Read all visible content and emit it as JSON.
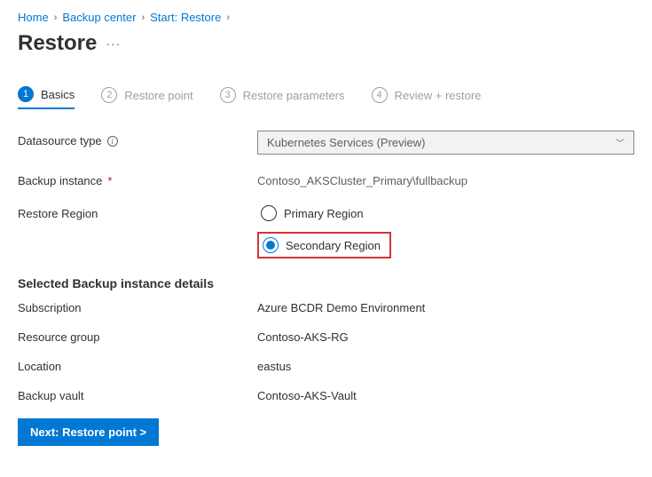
{
  "breadcrumb": {
    "home": "Home",
    "backup_center": "Backup center",
    "start_restore": "Start: Restore"
  },
  "page_title": "Restore",
  "tabs": {
    "basics": {
      "num": "1",
      "label": "Basics"
    },
    "restore_point": {
      "num": "2",
      "label": "Restore point"
    },
    "restore_params": {
      "num": "3",
      "label": "Restore parameters"
    },
    "review": {
      "num": "4",
      "label": "Review + restore"
    }
  },
  "fields": {
    "datasource_type": {
      "label": "Datasource type",
      "value": "Kubernetes Services (Preview)"
    },
    "backup_instance": {
      "label": "Backup instance",
      "value": "Contoso_AKSCluster_Primary\\fullbackup"
    },
    "restore_region": {
      "label": "Restore Region",
      "options": {
        "primary": "Primary Region",
        "secondary": "Secondary Region"
      },
      "selected": "secondary"
    }
  },
  "section_title": "Selected Backup instance details",
  "details": {
    "subscription": {
      "label": "Subscription",
      "value": "Azure BCDR Demo Environment"
    },
    "resource_group": {
      "label": "Resource group",
      "value": "Contoso-AKS-RG"
    },
    "location": {
      "label": "Location",
      "value": "eastus"
    },
    "backup_vault": {
      "label": "Backup vault",
      "value": "Contoso-AKS-Vault"
    }
  },
  "footer": {
    "next_button": "Next: Restore point >"
  }
}
